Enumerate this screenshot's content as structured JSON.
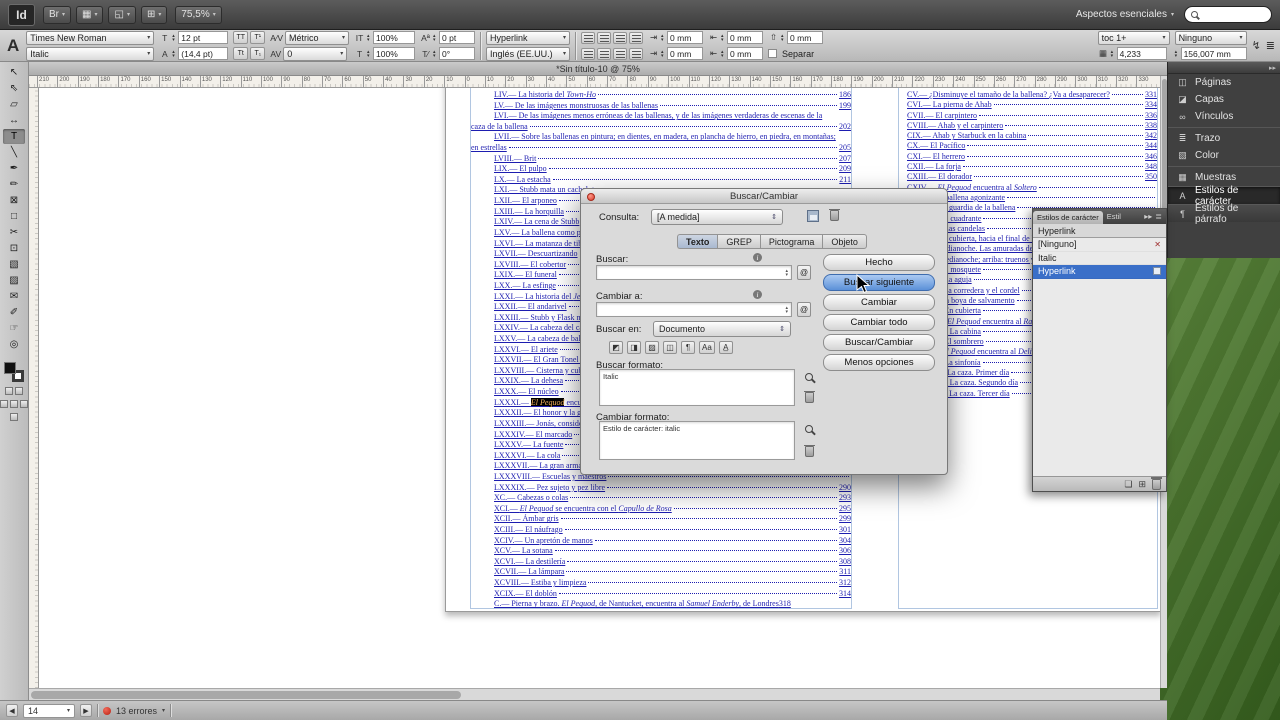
{
  "colors": {
    "accent_blue": "#3a6fc8",
    "hyperlink_text": "#1d1db0",
    "error_red": "#cc2222",
    "selection_highlight": "#000000"
  },
  "menubar": {
    "logo": "Id",
    "icons": [
      {
        "name": "bridge-icon",
        "glyph": "Br"
      },
      {
        "name": "view-options-icon",
        "glyph": "▦"
      },
      {
        "name": "screen-mode-icon",
        "glyph": "◱"
      },
      {
        "name": "arrange-documents-icon",
        "glyph": "⊞"
      }
    ],
    "zoom_value": "75,5%",
    "workspace": "Aspectos esenciales",
    "search_placeholder": ""
  },
  "controlbar": {
    "char_icon": "A",
    "font_family": "Times New Roman",
    "font_style": "Italic",
    "font_size": "12 pt",
    "leading": "(14,4 pt)",
    "kerning": "Métrico",
    "tracking": "0",
    "vscale": "100%",
    "hscale": "100%",
    "baseline": "0 pt",
    "skew": "0°",
    "char_style": "Hyperlink",
    "language": "Inglés (EE.UU.)",
    "indent_left": "0 mm",
    "indent_first": "0 mm",
    "indent_right": "0 mm",
    "indent_last": "0 mm",
    "space_before": "0 mm",
    "space_after": "0 mm",
    "separar": "Separar",
    "para_style": "toc 1+",
    "grid_value": "4,233",
    "stroke_type": "Ninguno",
    "frame_width": "156,007 mm"
  },
  "toolbar": {
    "tools": [
      {
        "name": "selection-tool",
        "glyph": "↖"
      },
      {
        "name": "direct-selection-tool",
        "glyph": "⇖"
      },
      {
        "name": "page-tool",
        "glyph": "▱"
      },
      {
        "name": "gap-tool",
        "glyph": "↔"
      },
      {
        "name": "type-tool",
        "glyph": "T",
        "active": true
      },
      {
        "name": "line-tool",
        "glyph": "╲"
      },
      {
        "name": "pen-tool",
        "glyph": "✒"
      },
      {
        "name": "pencil-tool",
        "glyph": "✏"
      },
      {
        "name": "rectangle-frame-tool",
        "glyph": "⊠"
      },
      {
        "name": "rectangle-tool",
        "glyph": "□"
      },
      {
        "name": "scissors-tool",
        "glyph": "✂"
      },
      {
        "name": "free-transform-tool",
        "glyph": "⊡"
      },
      {
        "name": "gradient-tool",
        "glyph": "▧"
      },
      {
        "name": "gradient-feather-tool",
        "glyph": "▨"
      },
      {
        "name": "note-tool",
        "glyph": "✉"
      },
      {
        "name": "eyedropper-tool",
        "glyph": "✐"
      },
      {
        "name": "hand-tool",
        "glyph": "☞"
      },
      {
        "name": "zoom-tool",
        "glyph": "◎"
      }
    ]
  },
  "tabbar": {
    "title": "*Sin título-10 @ 75%"
  },
  "ruler": {
    "labels": [
      210,
      200,
      190,
      180,
      170,
      160,
      150,
      140,
      130,
      120,
      110,
      100,
      90,
      80,
      70,
      60,
      50,
      40,
      30,
      20,
      10,
      0,
      10,
      20,
      30,
      40,
      50,
      60,
      70,
      80,
      90,
      100,
      110,
      120,
      130,
      140,
      150,
      160,
      170,
      180,
      190,
      200,
      210,
      220,
      230,
      240,
      250,
      260,
      270,
      280,
      290,
      300,
      310,
      320,
      330
    ]
  },
  "document": {
    "toc_left": [
      {
        "n": "LIV",
        "t": "La historia del *Town-Ho*",
        "p": "186"
      },
      {
        "n": "LV",
        "t": "De las imágenes monstruosas de las ballenas",
        "p": "199"
      },
      {
        "n": "LVI",
        "t": "De las imágenes menos erróneas de las ballenas, y de las imágenes verdaderas de escenas de la",
        "p": null
      },
      {
        "cont": true,
        "t": "caza de la ballena",
        "p": "202"
      },
      {
        "n": "LVII",
        "t": "Sobre las ballenas en pintura; en dientes, en madera, en plancha de hierro, en piedra, en montañas;",
        "p": null
      },
      {
        "cont": true,
        "t": "en estrellas",
        "p": "205"
      },
      {
        "n": "LVIII",
        "t": "Brit",
        "p": "207"
      },
      {
        "n": "LIX",
        "t": "El pulpo",
        "p": "209"
      },
      {
        "n": "LX",
        "t": "La estacha",
        "p": "211"
      },
      {
        "n": "LXI",
        "t": "Stubb mata un cachalote",
        "p": ""
      },
      {
        "n": "LXII",
        "t": "El arponeo",
        "p": ""
      },
      {
        "n": "LXIII",
        "t": "La horquilla",
        "p": ""
      },
      {
        "n": "LXIV",
        "t": "La cena de Stubb",
        "p": ""
      },
      {
        "n": "LXV",
        "t": "La ballena como plato",
        "p": ""
      },
      {
        "n": "LXVI",
        "t": "La matanza de tiburones",
        "p": ""
      },
      {
        "n": "LXVII",
        "t": "Descuartizando",
        "p": ""
      },
      {
        "n": "LXVIII",
        "t": "El cobertor",
        "p": ""
      },
      {
        "n": "LXIX",
        "t": "El funeral",
        "p": ""
      },
      {
        "n": "LXX",
        "t": "La esfinge",
        "p": ""
      },
      {
        "n": "LXXI",
        "t": "La historia del *Jeroboam*",
        "p": ""
      },
      {
        "n": "LXXII",
        "t": "El andarivel",
        "p": ""
      },
      {
        "n": "LXXIII",
        "t": "Stubb y Flask matan una ballena franca",
        "p": ""
      },
      {
        "n": "LXXIV",
        "t": "La cabeza del cachalote. Visión contrastada",
        "p": ""
      },
      {
        "n": "LXXV",
        "t": "La cabeza de ballena franca. Visión contrastada",
        "p": ""
      },
      {
        "n": "LXXVI",
        "t": "El ariete",
        "p": ""
      },
      {
        "n": "LXXVII",
        "t": "El Gran Tonel de Heidelberg",
        "p": ""
      },
      {
        "n": "LXXVIII",
        "t": "Cisterna y cubos",
        "p": ""
      },
      {
        "n": "LXXIX",
        "t": "La dehesa",
        "p": ""
      },
      {
        "n": "LXXX",
        "t": "El núcleo",
        "p": ""
      },
      {
        "n": "LXXXI",
        "t": "~El Pequod~ encuentra al *Virgen*",
        "p": ""
      },
      {
        "n": "LXXXII",
        "t": "El honor y la gloria de la caza de la ballena",
        "p": ""
      },
      {
        "n": "LXXXIII",
        "t": "Jonás, considerado históricamente",
        "p": ""
      },
      {
        "n": "LXXXIV",
        "t": "El marcado",
        "p": ""
      },
      {
        "n": "LXXXV",
        "t": "La fuente",
        "p": ""
      },
      {
        "n": "LXXXVI",
        "t": "La cola",
        "p": ""
      },
      {
        "n": "LXXXVII",
        "t": "La gran armada",
        "p": ""
      },
      {
        "n": "LXXXVIII",
        "t": "Escuelas y maestros",
        "p": ""
      },
      {
        "n": "LXXXIX",
        "t": "Pez sujeto y pez libre",
        "p": "290"
      },
      {
        "n": "XC",
        "t": "Cabezas o colas",
        "p": "293"
      },
      {
        "n": "XCI",
        "t": "*El Pequod* se encuentra con el *Capullo de Rosa*",
        "p": "295"
      },
      {
        "n": "XCII",
        "t": "Ámbar gris",
        "p": "299"
      },
      {
        "n": "XCIII",
        "t": "El náufrago",
        "p": "301"
      },
      {
        "n": "XCIV",
        "t": "Un apretón de manos",
        "p": "304"
      },
      {
        "n": "XCV",
        "t": "La sotana",
        "p": "306"
      },
      {
        "n": "XCVI",
        "t": "La destilería",
        "p": "308"
      },
      {
        "n": "XCVII",
        "t": "La lámpara",
        "p": "311"
      },
      {
        "n": "XCVIII",
        "t": "Estiba y limpieza",
        "p": "312"
      },
      {
        "n": "XCIX",
        "t": "El doblón",
        "p": "314"
      },
      {
        "n": "C",
        "t": "Pierna y brazo. *El Pequod*, de Nantucket, encuentra al *Samuel Enderby*, de Londres",
        "p": "318",
        "noleader": true
      }
    ],
    "toc_right": [
      {
        "n": "CV",
        "t": "¿Disminuye el tamaño de la ballena? ¿Va a desaparecer?",
        "p": "331"
      },
      {
        "n": "CVI",
        "t": "La pierna de Ahab",
        "p": "334"
      },
      {
        "n": "CVII",
        "t": "El carpintero",
        "p": "336"
      },
      {
        "n": "CVIII",
        "t": "Ahab y el carpintero",
        "p": "338"
      },
      {
        "n": "CIX",
        "t": "Ahab y Starbuck en la cabina",
        "p": "342"
      },
      {
        "n": "CX",
        "t": "El Pacífico",
        "p": "344"
      },
      {
        "n": "CXI",
        "t": "El herrero",
        "p": "346"
      },
      {
        "n": "CXII",
        "t": "La forja",
        "p": "348"
      },
      {
        "n": "CXIII",
        "t": "El dorador",
        "p": "350"
      },
      {
        "n": "CXIV",
        "t": "*El Pequod* encuentra al *Soltero*",
        "p": ""
      },
      {
        "n": "CXV",
        "t": "La ballena agonizante",
        "p": ""
      },
      {
        "n": "CXVI",
        "t": "La guardia de la ballena",
        "p": ""
      },
      {
        "n": "CXVII",
        "t": "El cuadrante",
        "p": ""
      },
      {
        "n": "CXVIII",
        "t": "Las candelas",
        "p": ""
      },
      {
        "n": "CXIX",
        "t": "La cubierta, hacia el final de la primera guardia nocturna",
        "p": ""
      },
      {
        "n": "CXX",
        "t": "Medianoche. Las amuradas de proa",
        "p": ""
      },
      {
        "n": "CXXI",
        "t": "Medianoche; arriba: truenos y relámpagos",
        "p": ""
      },
      {
        "n": "CXXII",
        "t": "El mosquete",
        "p": ""
      },
      {
        "n": "CXXIII",
        "t": "La aguja",
        "p": ""
      },
      {
        "n": "CXXIV",
        "t": "La corredera y el cordel",
        "p": ""
      },
      {
        "n": "CXXV",
        "t": "La boya de salvamento",
        "p": ""
      },
      {
        "n": "CXXVI",
        "t": "En cubierta",
        "p": ""
      },
      {
        "n": "CXXVII",
        "t": "*El Pequod* encuentra al *Raquel*",
        "p": ""
      },
      {
        "n": "CXXVIII",
        "t": "La cabina",
        "p": ""
      },
      {
        "n": "CXXIX",
        "t": "El sombrero",
        "p": ""
      },
      {
        "n": "CXXX",
        "t": "*El Pequod* encuentra al *Delicia*",
        "p": ""
      },
      {
        "n": "CXXXI",
        "t": "La sinfonía",
        "p": ""
      },
      {
        "n": "CXXXII",
        "t": "La caza. Primer día",
        "p": ""
      },
      {
        "n": "CXXXIII",
        "t": "La caza. Segundo día",
        "p": ""
      },
      {
        "n": "CXXXIV",
        "t": "La caza. Tercer día",
        "p": ""
      }
    ]
  },
  "dialog": {
    "title": "Buscar/Cambiar",
    "query_label": "Consulta:",
    "query_value": "[A medida]",
    "tabs": [
      "Texto",
      "GREP",
      "Pictograma",
      "Objeto"
    ],
    "active_tab": "Texto",
    "find_label": "Buscar:",
    "find_value": "",
    "change_label": "Cambiar a:",
    "change_value": "",
    "at_symbol": "@",
    "search_in_label": "Buscar en:",
    "search_in_value": "Documento",
    "option_icons": [
      {
        "name": "include-locked-layers-icon",
        "glyph": "◩"
      },
      {
        "name": "include-locked-stories-icon",
        "glyph": "◨"
      },
      {
        "name": "include-hidden-layers-icon",
        "glyph": "▨"
      },
      {
        "name": "include-master-pages-icon",
        "glyph": "◫"
      },
      {
        "name": "include-footnotes-icon",
        "glyph": "¶"
      },
      {
        "name": "case-sensitive-icon",
        "glyph": "Aa"
      },
      {
        "name": "whole-word-icon",
        "glyph": "A̲"
      }
    ],
    "find_format_label": "Buscar formato:",
    "find_format_value": "Italic",
    "change_format_label": "Cambiar formato:",
    "change_format_value": "Estilo de carácter: italic",
    "buttons": [
      {
        "label": "Hecho",
        "name": "done-button"
      },
      {
        "label": "Buscar siguiente",
        "name": "find-next-button",
        "primary": true
      },
      {
        "label": "Cambiar",
        "name": "change-button"
      },
      {
        "label": "Cambiar todo",
        "name": "change-all-button"
      },
      {
        "label": "Buscar/Cambiar",
        "name": "find-change-button"
      },
      {
        "label": "Menos opciones",
        "name": "fewer-options-button"
      }
    ]
  },
  "styles_panel": {
    "tab": "Estilos de carácter",
    "tab2": "Estil",
    "current": "Hyperlink",
    "rows": [
      {
        "name": "[Ninguno]",
        "icon": "x"
      },
      {
        "name": "Italic"
      },
      {
        "name": "Hyperlink",
        "selected": true,
        "icon": "disk"
      }
    ]
  },
  "dock": {
    "items": [
      {
        "label": "Páginas",
        "name": "dock-item-paginas",
        "icon": "pages-icon",
        "glyph": "◫"
      },
      {
        "label": "Capas",
        "name": "dock-item-capas",
        "icon": "layers-icon",
        "glyph": "◪"
      },
      {
        "label": "Vínculos",
        "name": "dock-item-vinculos",
        "icon": "links-icon",
        "glyph": "∞"
      },
      {
        "label": "Trazo",
        "name": "dock-item-trazo",
        "icon": "stroke-icon",
        "glyph": "≣",
        "div_before": true
      },
      {
        "label": "Color",
        "name": "dock-item-color",
        "icon": "color-icon",
        "glyph": "▧"
      },
      {
        "label": "Muestras",
        "name": "dock-item-muestras",
        "icon": "swatches-icon",
        "glyph": "▦",
        "div_before": true
      }
    ],
    "style_buttons": [
      {
        "label": "Estilos de carácter",
        "name": "dock-item-estilos-de-caracter",
        "icon": "character-styles-icon",
        "glyph": "A",
        "active": true
      },
      {
        "label": "Estilos de párrafo",
        "name": "dock-item-estilos-de-parrafo",
        "icon": "paragraph-styles-icon",
        "glyph": "¶"
      }
    ]
  },
  "statusbar": {
    "page_value": "14",
    "errors_label": "13 errores"
  }
}
